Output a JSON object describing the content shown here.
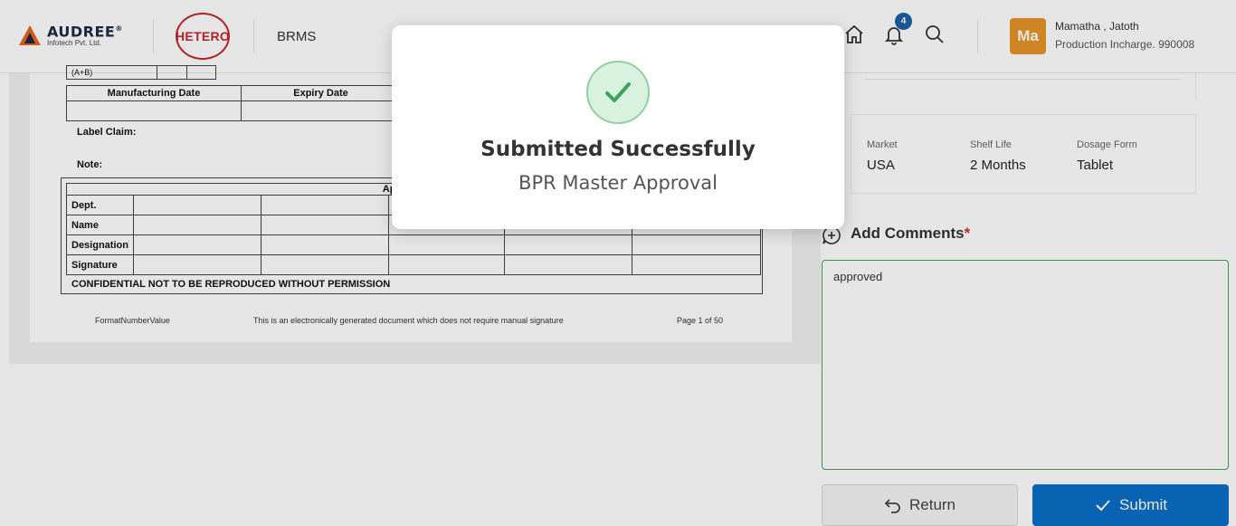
{
  "header": {
    "brand": {
      "name": "AUDREE",
      "registered": "®",
      "subtitle": "Infotech Pvt. Ltd."
    },
    "client_logo": "HETERO",
    "app_name": "BRMS",
    "notification_count": "4",
    "user": {
      "initials": "Ma",
      "name": "Mamatha , Jatoth",
      "role": "Production Incharge. 990008"
    },
    "icons": [
      "home-icon",
      "bell-icon",
      "search-icon"
    ]
  },
  "document": {
    "top_fragment": "(A+B)",
    "date_headers": [
      "Manufacturing Date",
      "Expiry Date"
    ],
    "label_claim": "Label Claim:",
    "note": "Note:",
    "approved_by": "Approved By",
    "approval_rows": [
      "Dept.",
      "Name",
      "Designation",
      "Signature"
    ],
    "confidential": "CONFIDENTIAL NOT TO BE REPRODUCED WITHOUT PERMISSION",
    "footer": {
      "format": "FormatNumberValue",
      "notice": "This is an electronically generated document which does not require manual signature",
      "page": "Page 1 of 50"
    }
  },
  "details": {
    "fields": [
      {
        "label": "Market",
        "value": "USA"
      },
      {
        "label": "Shelf Life",
        "value": "2 Months"
      },
      {
        "label": "Dosage Form",
        "value": "Tablet"
      }
    ]
  },
  "comments": {
    "title": "Add Comments",
    "required_mark": "*",
    "value": "approved"
  },
  "actions": {
    "return_label": "Return",
    "submit_label": "Submit"
  },
  "modal": {
    "title": "Submitted Successfully",
    "subtitle": "BPR Master Approval"
  },
  "colors": {
    "accent": "#0b6fc8",
    "success": "#3aa55a",
    "brand_red": "#c8242a",
    "avatar": "#e69528"
  }
}
